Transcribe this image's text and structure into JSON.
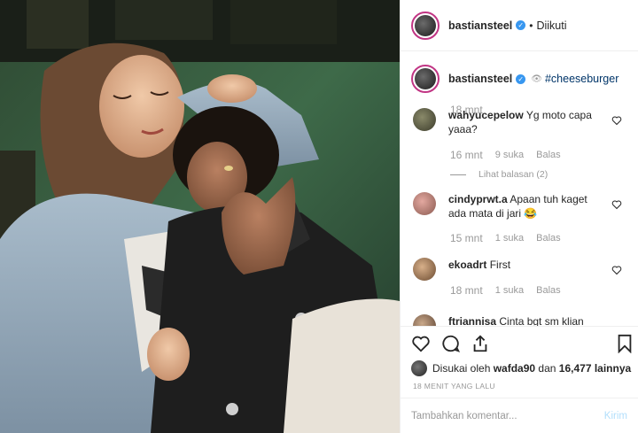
{
  "header": {
    "username": "bastiansteel",
    "separator": "•",
    "follow_status": "Diikuti"
  },
  "caption": {
    "username": "bastiansteel",
    "hashtag": "#cheeseburger",
    "time": "18 mnt"
  },
  "comments": [
    {
      "user": "wahyucepelow",
      "text": "Yg moto capa yaaa?",
      "time": "16 mnt",
      "likes": "9 suka",
      "reply": "Balas",
      "view_replies": "Lihat balasan (2)"
    },
    {
      "user": "cindyprwt.a",
      "text": "Apaan tuh kaget ada mata di jari 😂",
      "time": "15 mnt",
      "likes": "1 suka",
      "reply": "Balas"
    },
    {
      "user": "ekoadrt",
      "text": "First",
      "time": "18 mnt",
      "likes": "1 suka",
      "reply": "Balas"
    },
    {
      "user": "ftriannisa",
      "text": "Cinta bgt sm klian"
    }
  ],
  "likes": {
    "prefix": "Disukai oleh",
    "user": "wafda90",
    "mid": "dan",
    "count": "16,477 lainnya"
  },
  "timestamp": "18 MENIT YANG LALU",
  "add_comment": {
    "placeholder": "Tambahkan komentar...",
    "post_label": "Kirim"
  },
  "colors": {
    "link": "#003569",
    "verified": "#3897f0",
    "muted": "#999999",
    "story_ring": "#c13584"
  }
}
